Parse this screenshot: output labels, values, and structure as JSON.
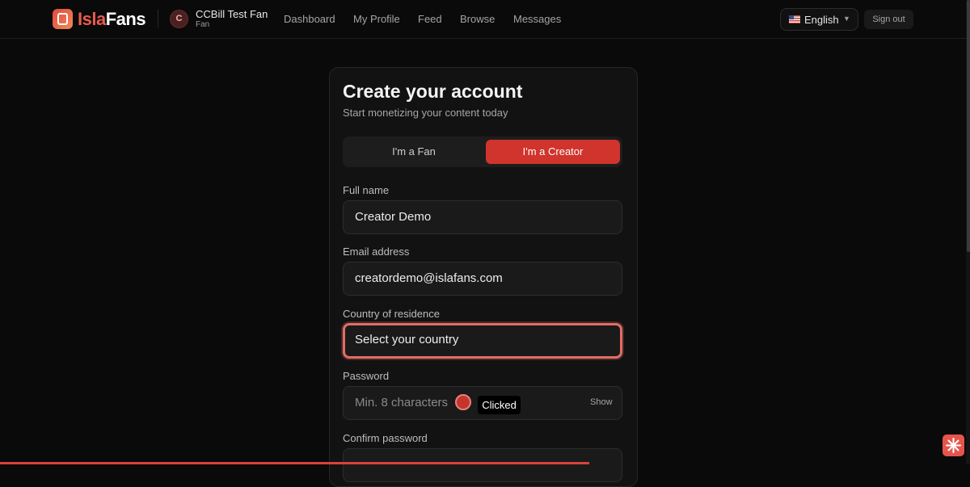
{
  "brand": {
    "left": "Isla",
    "right": "Fans",
    "icon": "islafans-logo-icon"
  },
  "user": {
    "initial": "C",
    "name": "CCBill Test Fan",
    "role": "Fan"
  },
  "nav": [
    "Dashboard",
    "My Profile",
    "Feed",
    "Browse",
    "Messages"
  ],
  "header": {
    "language": "English",
    "language_flag": "us-flag-icon",
    "sign_out": "Sign out"
  },
  "form": {
    "title": "Create your account",
    "subtitle": "Start monetizing your content today",
    "role_options": {
      "fan": "I'm a Fan",
      "creator": "I'm a Creator",
      "selected": "creator"
    },
    "full_name": {
      "label": "Full name",
      "value": "Creator Demo"
    },
    "email": {
      "label": "Email address",
      "value": "creatordemo@islafans.com"
    },
    "country": {
      "label": "Country of residence",
      "value": "Select your country"
    },
    "password": {
      "label": "Password",
      "placeholder": "Min. 8 characters",
      "toggle": "Show"
    },
    "confirm_password": {
      "label": "Confirm password"
    }
  },
  "click_indicator": {
    "label": "Clicked"
  },
  "colors": {
    "accent": "#d0342c",
    "focus_ring": "#e16d65",
    "background": "#0a0a0a",
    "card": "#121212"
  }
}
